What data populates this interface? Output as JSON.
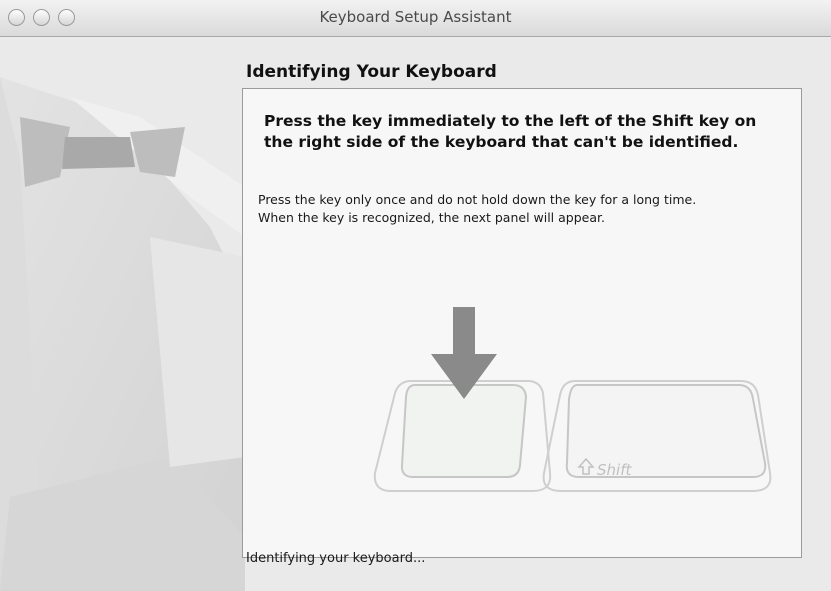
{
  "window": {
    "title": "Keyboard Setup Assistant",
    "controls": [
      "close",
      "minimize",
      "zoom"
    ]
  },
  "main": {
    "heading": "Identifying Your Keyboard",
    "instruction": "Press the key immediately to the left of the Shift key on the right side of the keyboard that can't be identified.",
    "details": [
      "Press the key only once and do not hold down the key for a long time.",
      "When the key is recognized, the next panel will appear."
    ],
    "illustration": {
      "arrow_icon": "down-arrow-icon",
      "shift_key_label": "Shift",
      "shift_icon": "shift-arrow-icon"
    }
  },
  "status": {
    "text": "Identifying your keyboard..."
  },
  "colors": {
    "window_background": "#eaeaea",
    "panel_background": "#f7f7f7",
    "arrow": "#8a8a8a"
  }
}
